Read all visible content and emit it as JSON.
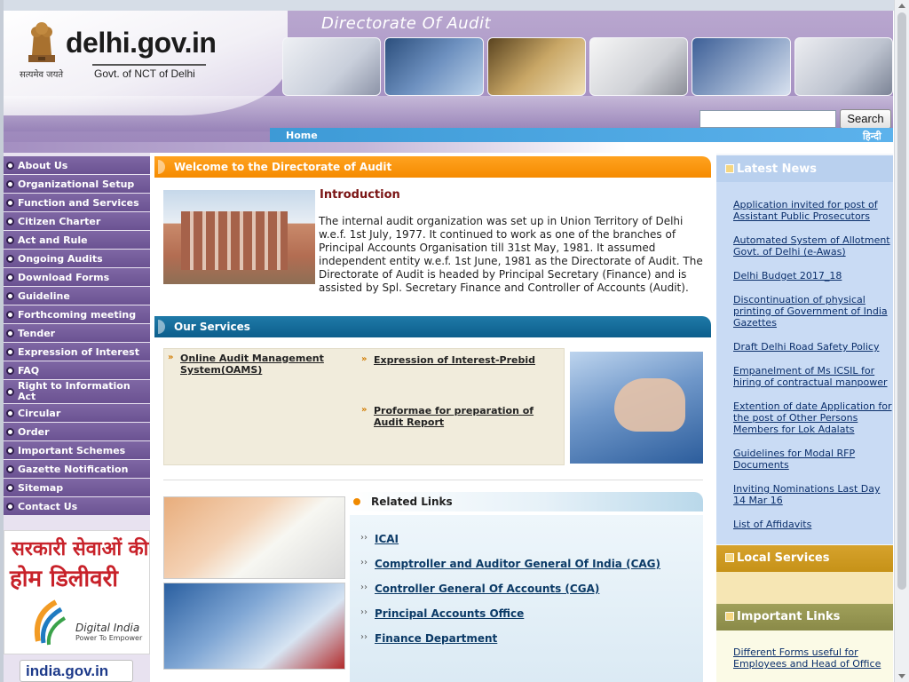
{
  "header": {
    "site_name": "delhi.gov.in",
    "site_sub": "Govt. of NCT of Delhi",
    "emblem_motto": "सत्यमेव जयते",
    "directorate_title": "Directorate Of Audit",
    "search_placeholder": "",
    "search_button": "Search",
    "nav_home": "Home",
    "nav_hindi": "हिन्दी"
  },
  "leftnav": {
    "items": [
      {
        "label": "About Us"
      },
      {
        "label": "Organizational Setup"
      },
      {
        "label": "Function and Services"
      },
      {
        "label": "Citizen Charter"
      },
      {
        "label": "Act and Rule"
      },
      {
        "label": "Ongoing Audits"
      },
      {
        "label": "Download Forms"
      },
      {
        "label": "Guideline"
      },
      {
        "label": "Forthcoming meeting"
      },
      {
        "label": "Tender"
      },
      {
        "label": "Expression of Interest"
      },
      {
        "label": "FAQ"
      },
      {
        "label": "Right to Information Act"
      },
      {
        "label": "Circular"
      },
      {
        "label": "Order"
      },
      {
        "label": "Important Schemes"
      },
      {
        "label": "Gazette Notification"
      },
      {
        "label": "Sitemap"
      },
      {
        "label": "Contact Us"
      }
    ],
    "promo_line1": "सरकारी सेवाओं की",
    "promo_line2": "होम डिलीवरी",
    "promo_logo": "Digital India",
    "promo_logo_sub": "Power To Empower",
    "india_gov": "india.gov.in"
  },
  "main": {
    "welcome_title": "Welcome to the Directorate of Audit",
    "intro_title": "Introduction",
    "intro_text": "The internal audit organization was set up in Union Territory of Delhi w.e.f. 1st July, 1977. It continued to work as one of the branches of Principal Accounts Organisation till 31st May, 1981. It assumed independent entity w.e.f. 1st June, 1981 as the Directorate of Audit. The Directorate of Audit is headed by Principal Secretary (Finance) and is assisted by Spl. Secretary Finance and Controller of Accounts (Audit).",
    "services_title": "Our Services",
    "services": [
      {
        "label": "Online Audit Management System(OAMS)"
      },
      {
        "label": "Expression of Interest-Prebid"
      },
      {
        "label": "Proformae for preparation of Audit Report"
      }
    ],
    "related_title": "Related Links",
    "related_links": [
      {
        "label": "ICAI"
      },
      {
        "label": "Comptroller and Auditor General Of India (CAG)"
      },
      {
        "label": "Controller General Of Accounts (CGA)"
      },
      {
        "label": "Principal Accounts Office"
      },
      {
        "label": "Finance Department"
      }
    ]
  },
  "right": {
    "latest_title": "Latest News",
    "news": [
      {
        "label": "Application invited for post of Assistant Public Prosecutors"
      },
      {
        "label": "Automated System of Allotment Govt. of Delhi (e-Awas)"
      },
      {
        "label": "Delhi Budget 2017_18"
      },
      {
        "label": "Discontinuation of physical printing of Government of India Gazettes"
      },
      {
        "label": "Draft Delhi Road Safety Policy"
      },
      {
        "label": "Empanelment of Ms ICSIL for hiring of contractual manpower"
      },
      {
        "label": "Extention of date Application for the post of Other Persons Members for Lok Adalats"
      },
      {
        "label": "Guidelines for Modal RFP Documents"
      },
      {
        "label": "Inviting Nominations Last Day 14 Mar 16"
      },
      {
        "label": "List of Affidavits"
      }
    ],
    "local_title": "Local Services",
    "important_title": "Important Links",
    "important": [
      {
        "label": "Different Forms useful for Employees and Head of Office"
      }
    ]
  }
}
